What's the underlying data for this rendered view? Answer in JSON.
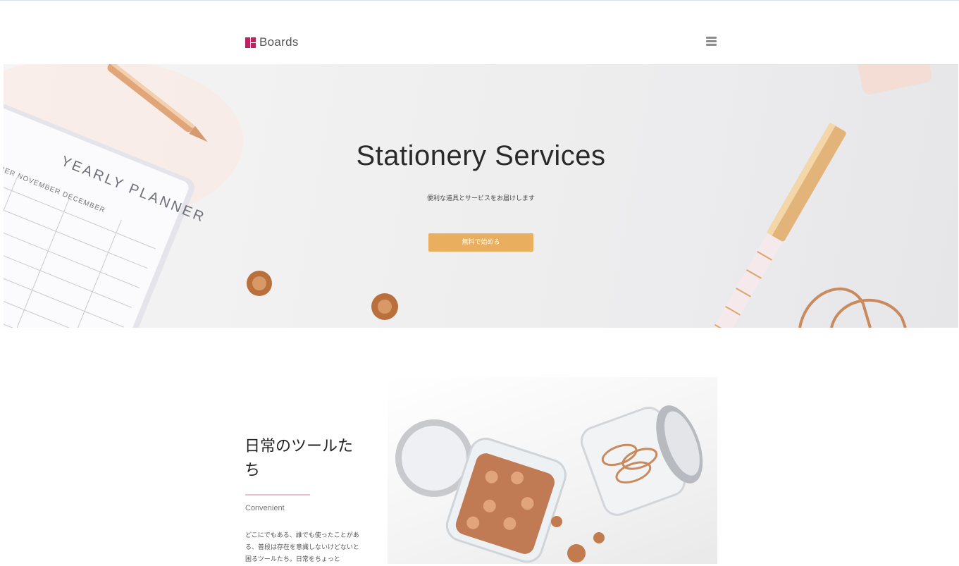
{
  "header": {
    "brand": "Boards",
    "brand_icon": "boards-logo-icon",
    "menu_icon": "hamburger-menu-icon",
    "brand_color": "#b8245f"
  },
  "hero": {
    "title": "Stationery Services",
    "subtitle": "便利な道具とサービスをお届けします",
    "cta_label": "無料で始める",
    "cta_color": "#e9ae5e"
  },
  "feature": {
    "title": "日常のツールたち",
    "tag": "Convenient",
    "body": "どこにでもある、誰でも使ったことがある、普段は存在を意識しないけどないと困るツールたち。日常をちょっと",
    "accent_color": "#edbfca"
  }
}
